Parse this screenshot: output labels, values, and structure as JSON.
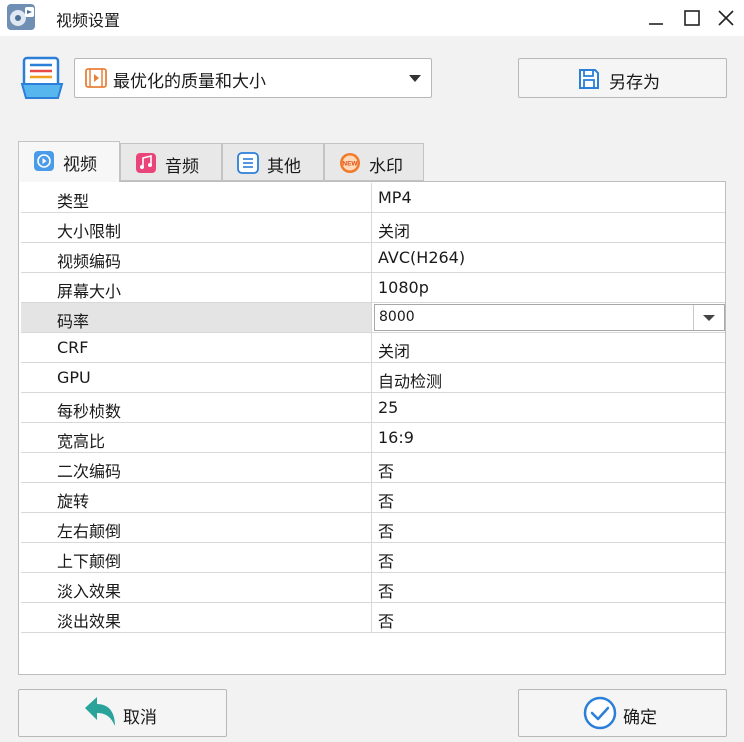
{
  "window": {
    "title": "视频设置",
    "controls": [
      "minimize",
      "maximize",
      "close"
    ]
  },
  "preset": {
    "selected": "最优化的质量和大小",
    "save_as_label": "另存为"
  },
  "tabs": [
    {
      "label": "视频",
      "icon": "play-circle-icon",
      "active": true
    },
    {
      "label": "音频",
      "icon": "music-note-icon",
      "active": false
    },
    {
      "label": "其他",
      "icon": "list-icon",
      "active": false
    },
    {
      "label": "水印",
      "icon": "new-badge-icon",
      "badge": "NEW",
      "active": false
    }
  ],
  "settings": {
    "rows": [
      {
        "label": "类型",
        "value": "MP4"
      },
      {
        "label": "大小限制",
        "value": "关闭"
      },
      {
        "label": "视频编码",
        "value": "AVC(H264)"
      },
      {
        "label": "屏幕大小",
        "value": "1080p"
      },
      {
        "label": "码率",
        "value": "8000",
        "control": "dropdown",
        "selected": true
      },
      {
        "label": "CRF",
        "value": "关闭"
      },
      {
        "label": "GPU",
        "value": "自动检测"
      },
      {
        "label": "每秒桢数",
        "value": "25"
      },
      {
        "label": "宽高比",
        "value": "16:9"
      },
      {
        "label": "二次编码",
        "value": "否"
      },
      {
        "label": "旋转",
        "value": "否"
      },
      {
        "label": "左右颠倒",
        "value": "否"
      },
      {
        "label": "上下颠倒",
        "value": "否"
      },
      {
        "label": "淡入效果",
        "value": "否"
      },
      {
        "label": "淡出效果",
        "value": "否"
      }
    ]
  },
  "buttons": {
    "cancel": "取消",
    "ok": "确定"
  },
  "colors": {
    "accent_blue": "#2b7fd9",
    "back_arrow_teal": "#2aa39a",
    "music_pink": "#e9457a",
    "badge_orange": "#f07a2a"
  }
}
